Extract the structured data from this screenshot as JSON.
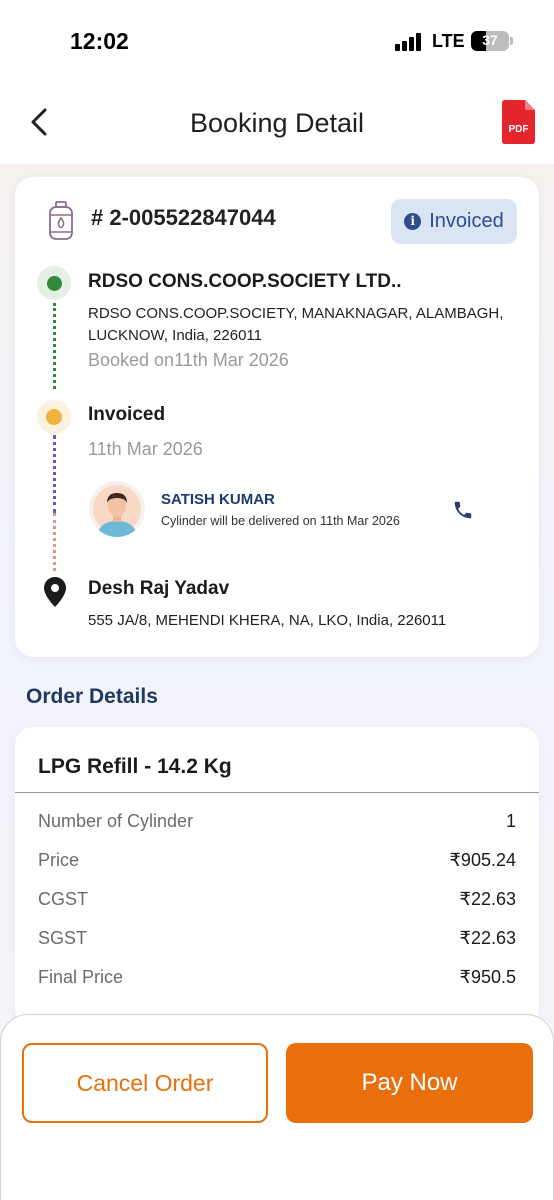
{
  "status_bar": {
    "time": "12:02",
    "network": "LTE",
    "battery": "37"
  },
  "header": {
    "title": "Booking Detail",
    "pdf_label": "PDF"
  },
  "booking": {
    "number": "# 2-005522847044",
    "status": "Invoiced",
    "dealer": {
      "name": "RDSO CONS.COOP.SOCIETY LTD..",
      "address": "RDSO CONS.COOP.SOCIETY, MANAKNAGAR, ALAMBAGH, LUCKNOW, India, 226011",
      "booked_on": "Booked on11th Mar 2026"
    },
    "invoice": {
      "title": "Invoiced",
      "date": "11th Mar 2026"
    },
    "delivery_person": {
      "name": "SATISH KUMAR",
      "note": "Cylinder will be delivered on 11th Mar 2026"
    },
    "customer": {
      "name": "Desh Raj Yadav",
      "address": "555 JA/8, MEHENDI KHERA, NA, LKO, India, 226011"
    }
  },
  "order": {
    "section_title": "Order Details",
    "product": "LPG Refill - 14.2 Kg",
    "rows": [
      {
        "label": "Number of Cylinder",
        "value": "1"
      },
      {
        "label": "Price",
        "value": "₹905.24"
      },
      {
        "label": "CGST",
        "value": "₹22.63"
      },
      {
        "label": "SGST",
        "value": "₹22.63"
      },
      {
        "label": "Final Price",
        "value": "₹950.5"
      }
    ]
  },
  "actions": {
    "cancel": "Cancel Order",
    "pay": "Pay Now"
  },
  "colors": {
    "accent_orange": "#e86f0c",
    "status_blue": "#2d4d8e",
    "dealer_green": "#2f8a3b",
    "invoice_amber": "#f2b23d"
  }
}
